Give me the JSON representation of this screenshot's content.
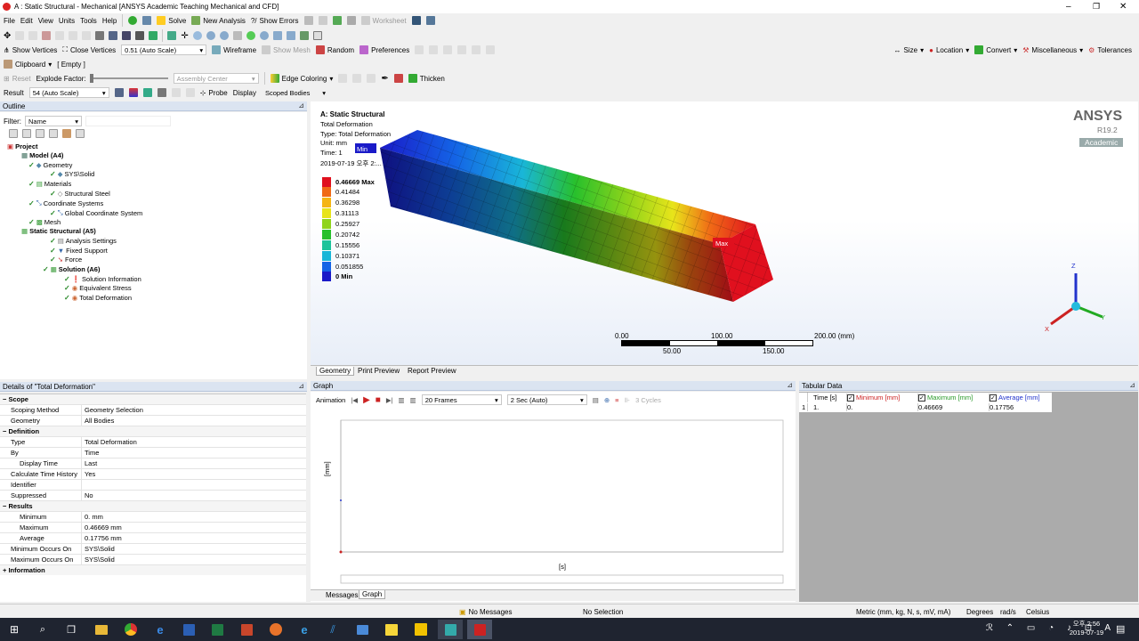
{
  "window": {
    "title": "A : Static Structural - Mechanical [ANSYS Academic Teaching Mechanical and CFD]"
  },
  "menu": [
    "File",
    "Edit",
    "View",
    "Units",
    "Tools",
    "Help"
  ],
  "toolbar1": {
    "solve": "Solve",
    "new_analysis": "New Analysis",
    "show_errors": "Show Errors",
    "worksheet": "Worksheet"
  },
  "toolbar3": {
    "show_vertices": "Show Vertices",
    "close_vertices": "Close Vertices",
    "scale": "0.51 (Auto Scale)",
    "wireframe": "Wireframe",
    "show_mesh": "Show Mesh",
    "random": "Random",
    "preferences": "Preferences",
    "size": "Size",
    "location": "Location",
    "convert": "Convert",
    "miscellaneous": "Miscellaneous",
    "tolerances": "Tolerances"
  },
  "toolbar4": {
    "clipboard": "Clipboard",
    "empty": "[ Empty ]"
  },
  "toolbar5": {
    "reset": "Reset",
    "explode": "Explode Factor:",
    "assembly_center": "Assembly Center",
    "edge_coloring": "Edge Coloring",
    "thicken": "Thicken"
  },
  "toolbar6": {
    "result": "Result",
    "result_scale": "54 (Auto Scale)",
    "probe": "Probe",
    "display": "Display",
    "scoped_bodies": "Scoped Bodies"
  },
  "outline": {
    "title": "Outline",
    "filter_label": "Filter:",
    "filter_value": "Name",
    "items": [
      {
        "label": "Project",
        "bold": true
      },
      {
        "label": "Model (A4)",
        "bold": true
      },
      {
        "label": "Geometry"
      },
      {
        "label": "SYS\\Solid"
      },
      {
        "label": "Materials"
      },
      {
        "label": "Structural Steel"
      },
      {
        "label": "Coordinate Systems"
      },
      {
        "label": "Global Coordinate System"
      },
      {
        "label": "Mesh"
      },
      {
        "label": "Static Structural (A5)",
        "bold": true
      },
      {
        "label": "Analysis Settings"
      },
      {
        "label": "Fixed Support"
      },
      {
        "label": "Force"
      },
      {
        "label": "Solution (A6)",
        "bold": true
      },
      {
        "label": "Solution Information"
      },
      {
        "label": "Equivalent Stress"
      },
      {
        "label": "Total Deformation"
      }
    ]
  },
  "viewport": {
    "title": "A: Static Structural",
    "lines": [
      "Total Deformation",
      "Type: Total Deformation",
      "Unit: mm",
      "Time: 1",
      "2019-07-19 오후 2:..."
    ],
    "min_tag": "Min",
    "max_tag": "Max",
    "brand": "ANSYS",
    "version": "R19.2",
    "edition": "Academic",
    "legend": [
      {
        "label": "0.46669 Max",
        "color": "#e0101e"
      },
      {
        "label": "0.41484",
        "color": "#f06a16"
      },
      {
        "label": "0.36298",
        "color": "#f5b514"
      },
      {
        "label": "0.31113",
        "color": "#e8e41a"
      },
      {
        "label": "0.25927",
        "color": "#8fd41a"
      },
      {
        "label": "0.20742",
        "color": "#28c02c"
      },
      {
        "label": "0.15556",
        "color": "#1ec39a"
      },
      {
        "label": "0.10371",
        "color": "#19b6d8"
      },
      {
        "label": "0.051855",
        "color": "#1464e6"
      },
      {
        "label": "0 Min",
        "color": "#1a1ac8"
      }
    ],
    "scale": {
      "t0": "0.00",
      "t100": "100.00",
      "t200": "200.00 (mm)",
      "t50": "50.00",
      "t150": "150.00"
    },
    "axes": {
      "z": "Z",
      "y": "Y",
      "x": "X"
    }
  },
  "view_tabs": [
    "Geometry",
    "Print Preview",
    "Report Preview"
  ],
  "details": {
    "title": "Details of \"Total Deformation\"",
    "rows": [
      {
        "section": "Scope"
      },
      {
        "k": "Scoping Method",
        "v": "Geometry Selection"
      },
      {
        "k": "Geometry",
        "v": "All Bodies"
      },
      {
        "section": "Definition"
      },
      {
        "k": "Type",
        "v": "Total Deformation"
      },
      {
        "k": "By",
        "v": "Time"
      },
      {
        "k": "Display Time",
        "v": "Last"
      },
      {
        "k": "Calculate Time History",
        "v": "Yes"
      },
      {
        "k": "Identifier",
        "v": ""
      },
      {
        "k": "Suppressed",
        "v": "No"
      },
      {
        "section": "Results"
      },
      {
        "k": "Minimum",
        "v": "0. mm"
      },
      {
        "k": "Maximum",
        "v": "0.46669 mm"
      },
      {
        "k": "Average",
        "v": "0.17756 mm"
      },
      {
        "k": "Minimum Occurs On",
        "v": "SYS\\Solid"
      },
      {
        "k": "Maximum Occurs On",
        "v": "SYS\\Solid"
      },
      {
        "section": "Information"
      }
    ]
  },
  "graph": {
    "title": "Graph",
    "animation": "Animation",
    "frames": "20 Frames",
    "duration": "2 Sec (Auto)",
    "cycles": "3 Cycles",
    "ylabel": "[mm]",
    "xlabel": "[s]",
    "tabs": [
      "Messages",
      "Graph"
    ]
  },
  "tabular": {
    "title": "Tabular Data",
    "headers": [
      "Time [s]",
      "Minimum [mm]",
      "Maximum [mm]",
      "Average [mm]"
    ],
    "rows": [
      [
        "1",
        "1.",
        "0.",
        "0.46669",
        "0.17756"
      ]
    ]
  },
  "status": {
    "messages": "No Messages",
    "selection": "No Selection",
    "units": "Metric (mm, kg, N, s, mV, mA)",
    "angle": "Degrees",
    "rate": "rad/s",
    "temp": "Celsius"
  },
  "clock": {
    "time": "오후 2:56",
    "date": "2019-07-19"
  }
}
